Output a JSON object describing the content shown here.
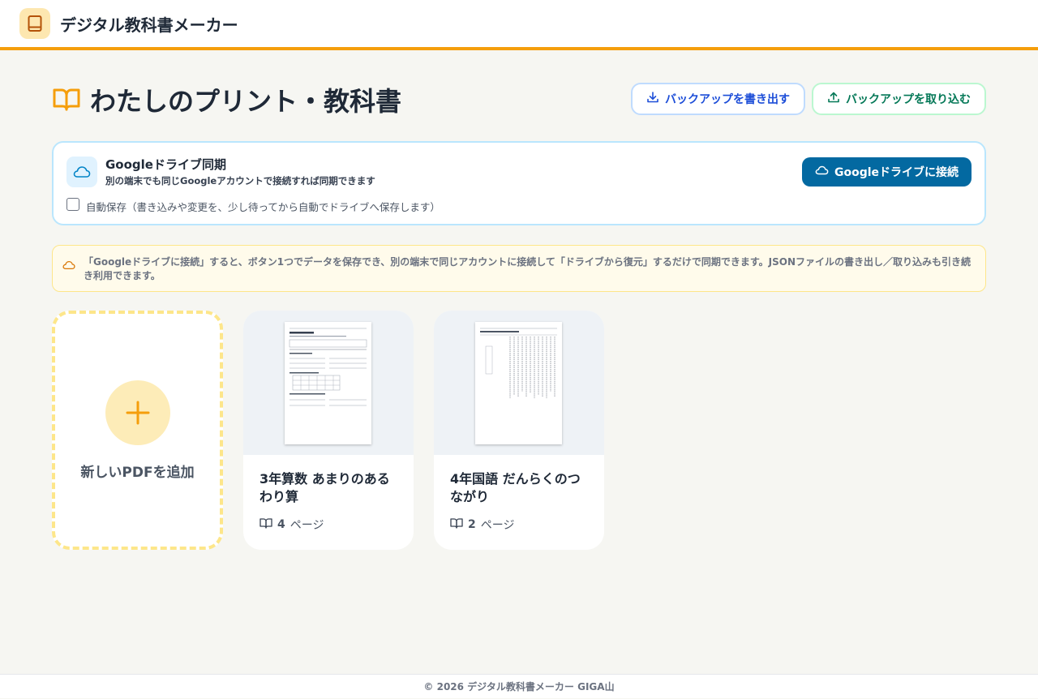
{
  "header": {
    "app_title": "デジタル教科書メーカー",
    "logo_icon": "book-icon"
  },
  "page": {
    "title": "わたしのプリント・教科書",
    "title_icon": "open-book-icon"
  },
  "actions": {
    "export_label": "バックアップを書き出す",
    "import_label": "バックアップを取り込む"
  },
  "sync": {
    "title": "Googleドライブ同期",
    "description": "別の端末でも同じGoogleアカウントで接続すれば同期できます",
    "auto_save_label": "自動保存（書き込みや変更を、少し待ってから自動でドライブへ保存します）",
    "auto_save_checked": false,
    "connect_label": "Googleドライブに接続"
  },
  "info": {
    "text": "「Googleドライブに接続」すると、ボタン1つでデータを保存でき、別の端末で同じアカウントに接続して「ドライブから復元」するだけで同期できます。JSONファイルの書き出し／取り込みも引き続き利用できます。"
  },
  "library": {
    "add_label": "新しいPDFを追加",
    "books": [
      {
        "title": "3年算数 あまりのあるわり算",
        "page_count": "4",
        "pages_unit": "ページ"
      },
      {
        "title": "4年国語 だんらくのつながり",
        "page_count": "2",
        "pages_unit": "ページ"
      }
    ]
  },
  "footer": {
    "text": "© 2026 デジタル教科書メーカー GIGA山"
  },
  "colors": {
    "accent": "#f59e0b",
    "primary_button": "#0369a1",
    "export_text": "#1d4ed8",
    "import_text": "#047857",
    "background": "#f6f6f2"
  }
}
